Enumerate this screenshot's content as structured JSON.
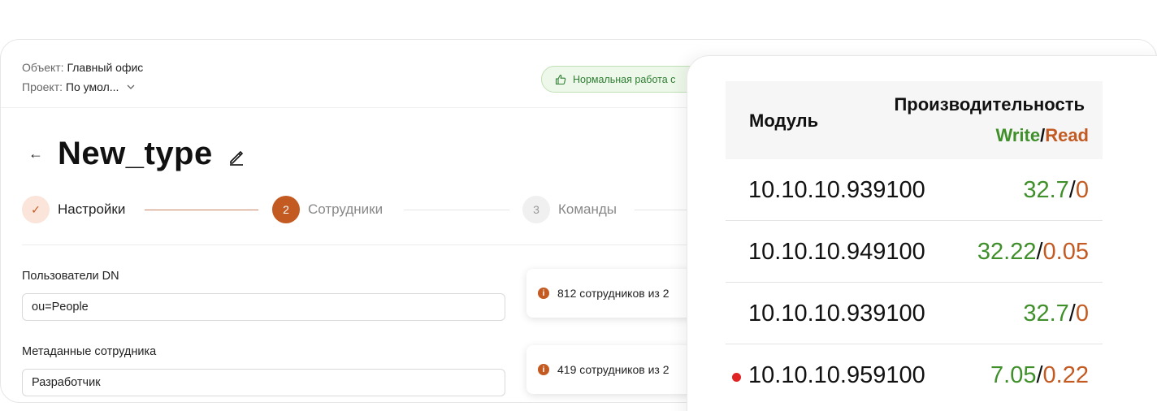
{
  "header": {
    "object_key": "Объект:",
    "object_value": "Главный офис",
    "project_key": "Проект:",
    "project_value": "По умол...",
    "status_text": "Нормальная работа с"
  },
  "page": {
    "title": "New_type"
  },
  "stepper": {
    "steps": [
      {
        "number": "✓",
        "label": "Настройки"
      },
      {
        "number": "2",
        "label": "Сотрудники"
      },
      {
        "number": "3",
        "label": "Команды"
      }
    ]
  },
  "form": {
    "fields": [
      {
        "label": "Пользователи DN",
        "value": "ou=People"
      },
      {
        "label": "Метаданные сотрудника",
        "value": "Разработчик"
      }
    ],
    "info": [
      {
        "icon": "i",
        "text": "812 сотрудников из 2"
      },
      {
        "icon": "i",
        "text": "419 сотрудников из 2"
      }
    ]
  },
  "performance": {
    "col_module": "Модуль",
    "col_perf": "Производительность",
    "write_label": "Write",
    "read_label": "Read",
    "slash": "/",
    "rows": [
      {
        "module": "10.10.10.939100",
        "write": "32.7",
        "read": "0",
        "alert": false
      },
      {
        "module": "10.10.10.949100",
        "write": "32.22",
        "read": "0.05",
        "alert": false
      },
      {
        "module": "10.10.10.939100",
        "write": "32.7",
        "read": "0",
        "alert": false
      },
      {
        "module": "10.10.10.959100",
        "write": "7.05",
        "read": "0.22",
        "alert": true
      }
    ],
    "colors": {
      "write": "#3f8f2a",
      "read": "#c25a22",
      "alert": "#e02424"
    }
  }
}
